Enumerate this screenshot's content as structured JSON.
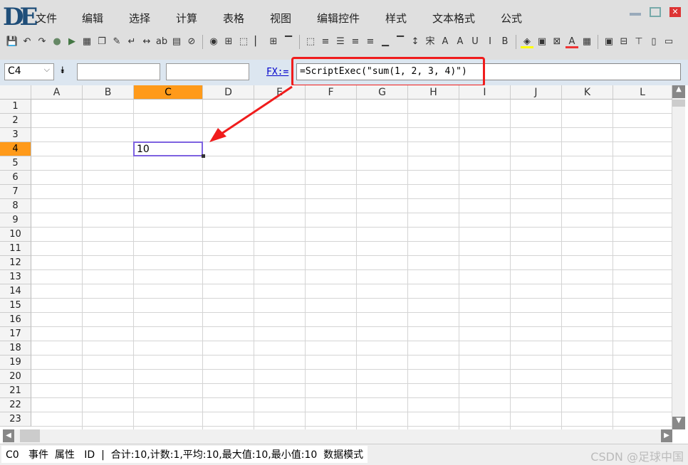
{
  "app": {
    "logo": "DE"
  },
  "menu": [
    "文件",
    "编辑",
    "选择",
    "计算",
    "表格",
    "视图",
    "编辑控件",
    "样式",
    "文本格式",
    "公式"
  ],
  "toolbar_icons": [
    "save",
    "undo",
    "redo",
    "record",
    "run",
    "table",
    "copy",
    "format-paint",
    "wrap",
    "column-width",
    "spell",
    "grid",
    "hide",
    "view",
    "border-all",
    "border-none",
    "border-left",
    "border-inner",
    "border-top",
    "border-dots",
    "align-center",
    "align-middle",
    "align-left",
    "align-right",
    "align-bottom",
    "align-top",
    "line-spacing",
    "font",
    "font-increase",
    "font-decrease",
    "underline",
    "italic",
    "bold",
    "fill-color",
    "image",
    "delete-image",
    "font-color",
    "cell-pattern",
    "picture",
    "insert-row",
    "insert-col",
    "split-v",
    "split-h"
  ],
  "formula_bar": {
    "cell_ref": "C4",
    "fx_label": "FX:=",
    "formula": "=ScriptExec(\"sum(1, 2, 3, 4)\")",
    "field1": "",
    "field2": ""
  },
  "columns": [
    "A",
    "B",
    "C",
    "D",
    "E",
    "F",
    "G",
    "H",
    "I",
    "J",
    "K",
    "L"
  ],
  "rows": [
    "1",
    "2",
    "3",
    "4",
    "5",
    "6",
    "7",
    "8",
    "9",
    "10",
    "11",
    "12",
    "13",
    "14",
    "15",
    "16",
    "17",
    "18",
    "19",
    "20",
    "21",
    "22",
    "23"
  ],
  "active_cell": {
    "ref": "C4",
    "value": "10"
  },
  "status": {
    "text": "C0   事件  属性   ID  |  合计:10,计数:1,平均:10,最大值:10,最小值:10  数据模式",
    "watermark": "CSDN @足球中国"
  },
  "colors": {
    "accent": "#ff9a1a",
    "highlight": "#f01c1c",
    "selection": "#7d62e0"
  }
}
